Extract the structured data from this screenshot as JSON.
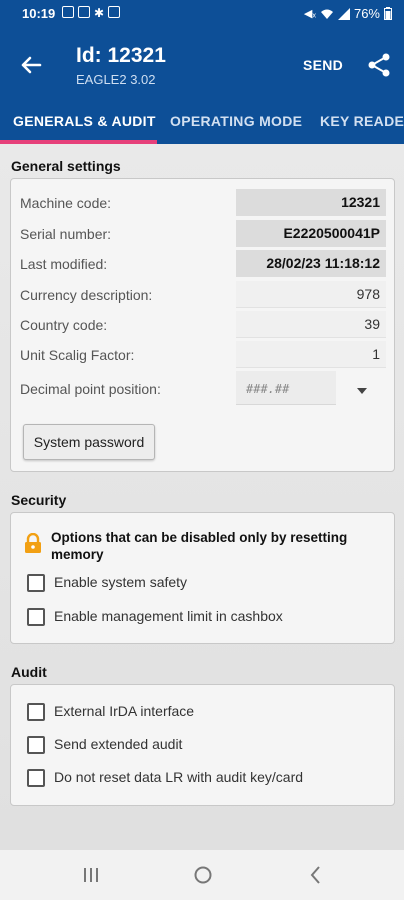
{
  "status_bar": {
    "time": "10:19",
    "battery": "76%",
    "left_icons": [
      "image-icon",
      "mail-icon",
      "settings-icon",
      "card-icon"
    ],
    "right_icons": [
      "mute-icon",
      "wifi-icon",
      "signal-icon",
      "battery-icon"
    ]
  },
  "app_bar": {
    "title": "Id: 12321",
    "subtitle": "EAGLE2 3.02",
    "send_label": "SEND",
    "back_icon": "arrow-back-icon",
    "share_icon": "share-icon"
  },
  "tabs": [
    {
      "label": "GENERALS & AUDIT",
      "active": true
    },
    {
      "label": "OPERATING MODE",
      "active": false
    },
    {
      "label": "KEY READER",
      "active": false
    }
  ],
  "general_settings": {
    "title": "General settings",
    "fields": [
      {
        "label": "Machine code:",
        "value": "12321",
        "readonly": true
      },
      {
        "label": "Serial number:",
        "value": "E2220500041P",
        "readonly": true
      },
      {
        "label": "Last modified:",
        "value": "28/02/23 11:18:12",
        "readonly": true
      },
      {
        "label": "Currency description:",
        "value": "978",
        "readonly": false
      },
      {
        "label": "Country code:",
        "value": "39",
        "readonly": false
      },
      {
        "label": "Unit Scalig Factor:",
        "value": "1",
        "readonly": false
      }
    ],
    "decimal_point": {
      "label": "Decimal point position:",
      "placeholder": "###.##"
    },
    "system_password_label": "System password"
  },
  "security": {
    "title": "Security",
    "warning": "Options that can be disabled only by resetting memory",
    "options": [
      {
        "label": "Enable system safety",
        "checked": false
      },
      {
        "label": "Enable management limit in cashbox",
        "checked": false
      }
    ]
  },
  "audit": {
    "title": "Audit",
    "options": [
      {
        "label": "External IrDA interface",
        "checked": false
      },
      {
        "label": "Send extended audit",
        "checked": false
      },
      {
        "label": "Do not reset data LR with audit key/card",
        "checked": false
      }
    ]
  },
  "colors": {
    "primary": "#0d4f97",
    "tab_indicator": "#e6407a",
    "warning_icon": "#f2a013"
  }
}
